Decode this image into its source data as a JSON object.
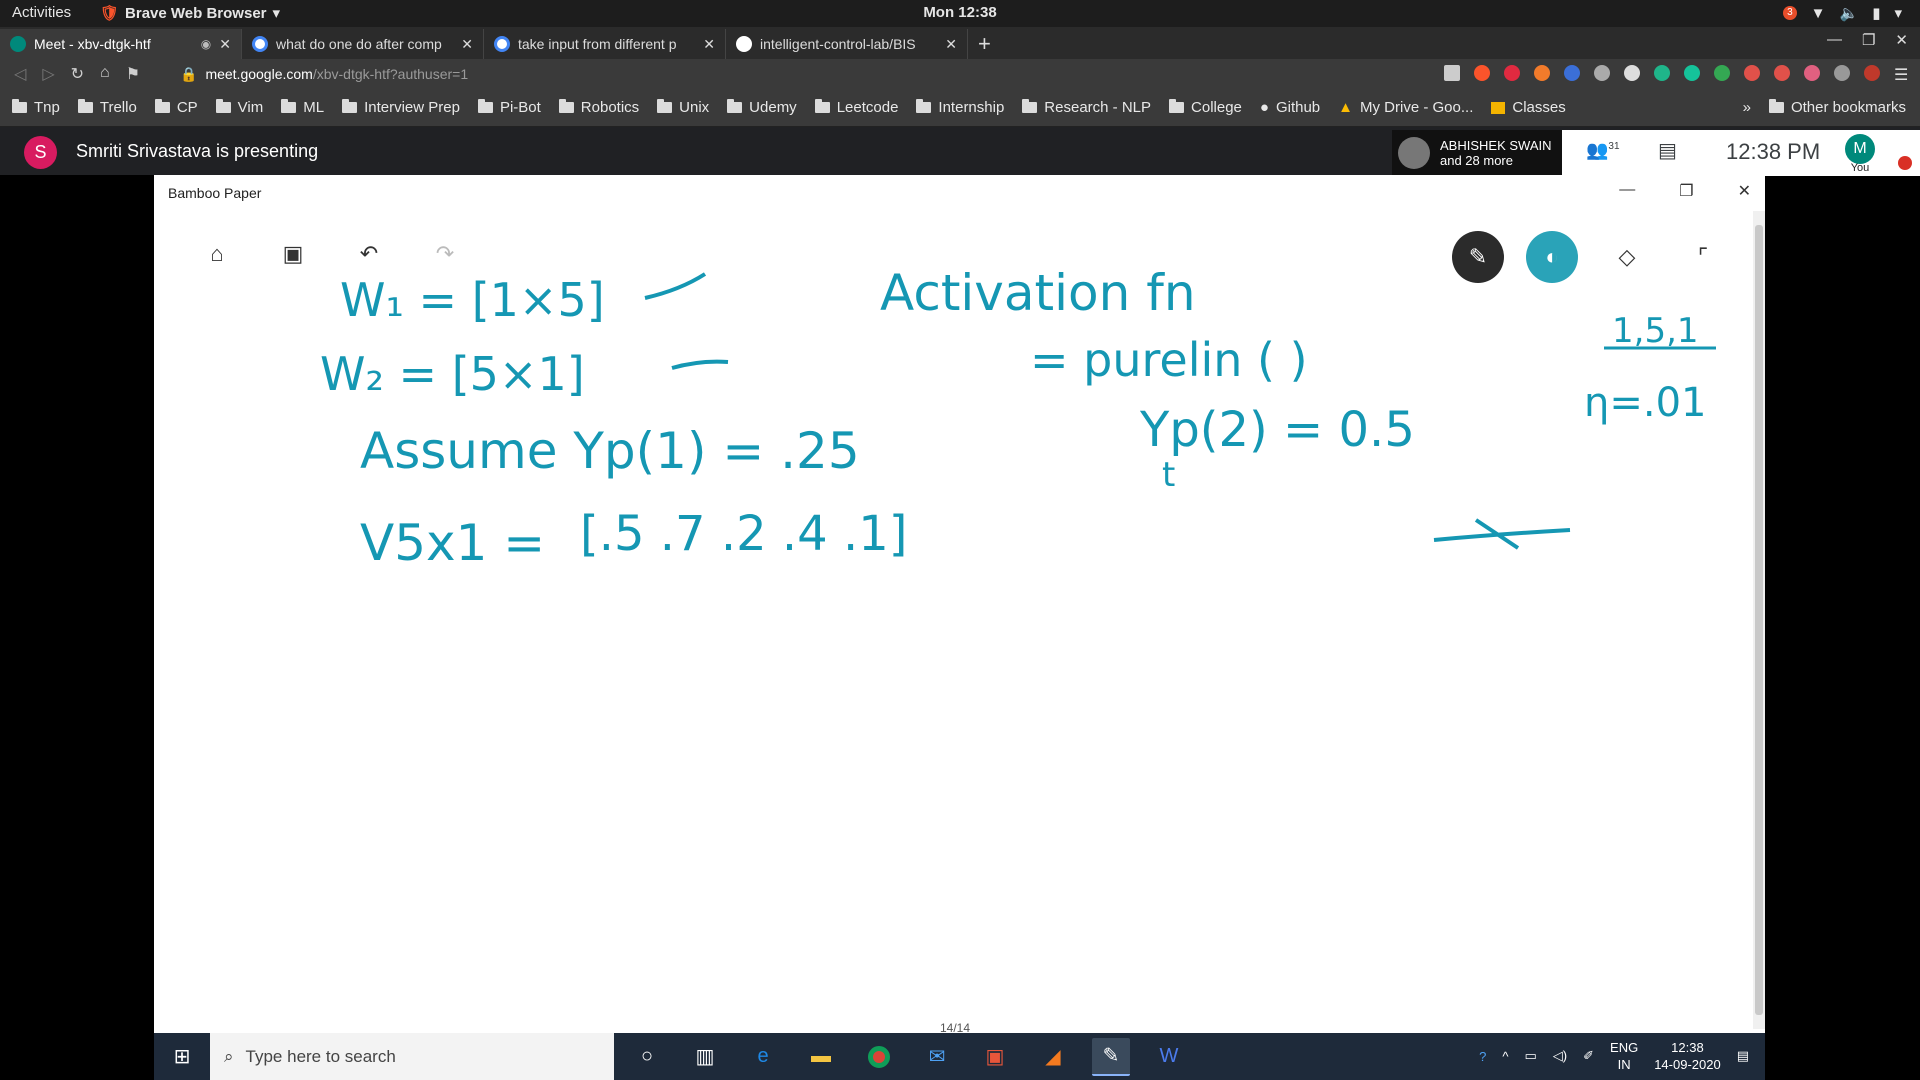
{
  "topbar": {
    "activities": "Activities",
    "app_menu": "Brave Web Browser",
    "clock": "Mon 12:38",
    "notification_count": "3"
  },
  "tabs": [
    {
      "title": "Meet - xbv-dtgk-htf",
      "favicon_color": "#00897b"
    },
    {
      "title": "what do one do after comp",
      "favicon_color": "#4285f4"
    },
    {
      "title": "take input from different p",
      "favicon_color": "#4285f4"
    },
    {
      "title": "intelligent-control-lab/BIS",
      "favicon_color": "#ffffff"
    }
  ],
  "address_bar": {
    "host": "meet.google.com",
    "path": "/xbv-dtgk-htf?authuser=1"
  },
  "bookmarks": [
    "Tnp",
    "Trello",
    "CP",
    "Vim",
    "ML",
    "Interview Prep",
    "Pi-Bot",
    "Robotics",
    "Unix",
    "Udemy",
    "Leetcode",
    "Internship",
    "Research - NLP",
    "College",
    "Github",
    "My Drive - Goo...",
    "Classes"
  ],
  "bookmarks_overflow": "»",
  "other_bookmarks": "Other bookmarks",
  "meet": {
    "presenter_initial": "S",
    "presenting_text": "Smriti Srivastava is presenting",
    "participant_name": "ABHISHEK SWAIN",
    "participant_more": "and 28 more",
    "people_count": "31",
    "time": "12:38 PM",
    "self_initial": "M",
    "self_label": "You"
  },
  "bamboo": {
    "window_title": "Bamboo Paper",
    "page_indicator": "14/14",
    "ink_lines": [
      "W₁ = [1×5]",
      "W₂ = [5×1]",
      "Activation fn",
      "= purelin ( )",
      "1,5,1",
      "η=.01",
      "Assume  Yp(1) = .25",
      "Yp(2) = 0.5",
      "V5x1 =",
      "[.5   .7   .2   .4   .1]",
      "t"
    ]
  },
  "taskbar": {
    "search_placeholder": "Type here to search",
    "lang_top": "ENG",
    "lang_bottom": "IN",
    "time": "12:38",
    "date": "14-09-2020"
  },
  "colors": {
    "ink": "#1597b3",
    "meet_avatar": "#d81b60",
    "pen_active": "#2aa3b8"
  }
}
